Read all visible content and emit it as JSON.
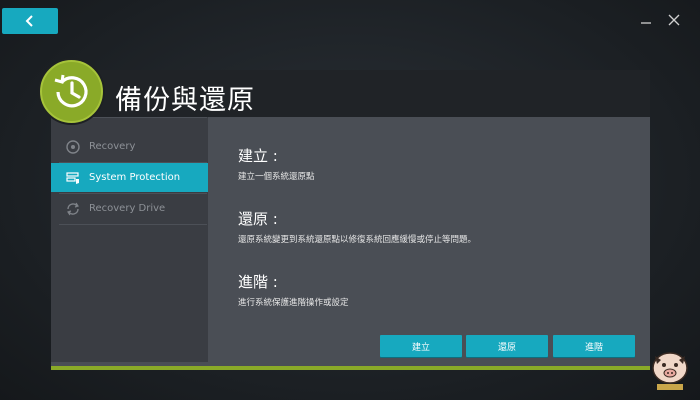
{
  "app": {
    "title": "備份與還原"
  },
  "sidebar": {
    "items": [
      {
        "label": "Recovery",
        "icon": "recovery-icon",
        "active": false
      },
      {
        "label": "System Protection",
        "icon": "system-protection-icon",
        "active": true
      },
      {
        "label": "Recovery Drive",
        "icon": "recovery-drive-icon",
        "active": false
      }
    ]
  },
  "sections": [
    {
      "title": "建立 :",
      "description": "建立一個系統還原點"
    },
    {
      "title": "還原 :",
      "description": "還原系統變更到系統還原點以修復系統回應緩慢或停止等問題。"
    },
    {
      "title": "進階 :",
      "description": "進行系統保護進階操作或設定"
    }
  ],
  "buttons": {
    "create": "建立",
    "restore": "還原",
    "advanced": "進階"
  },
  "colors": {
    "accent": "#17a9bf",
    "brand_green": "#8aaa28",
    "panel": "#4a4e55",
    "header": "#202327"
  }
}
